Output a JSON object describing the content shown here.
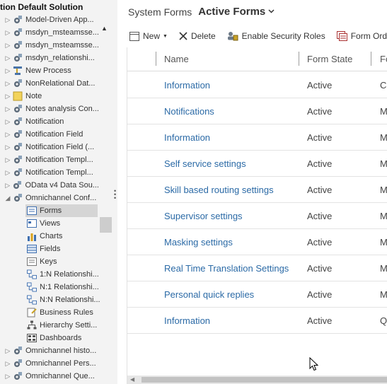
{
  "tree": {
    "title": "tion Default Solution",
    "items": [
      {
        "label": "Model-Driven App...",
        "icon": "gear-icon",
        "expanded": false
      },
      {
        "label": "msdyn_msteamsse...",
        "icon": "gear-icon",
        "expanded": false
      },
      {
        "label": "msdyn_msteamsse...",
        "icon": "gear-icon",
        "expanded": false
      },
      {
        "label": "msdyn_relationshi...",
        "icon": "gear-icon",
        "expanded": false
      },
      {
        "label": "New Process",
        "icon": "process-icon",
        "expanded": false
      },
      {
        "label": "NonRelational Dat...",
        "icon": "gear-icon",
        "expanded": false
      },
      {
        "label": "Note",
        "icon": "note-icon",
        "expanded": false
      },
      {
        "label": "Notes analysis Con...",
        "icon": "gear-icon",
        "expanded": false
      },
      {
        "label": "Notification",
        "icon": "gear-icon",
        "expanded": false
      },
      {
        "label": "Notification Field",
        "icon": "gear-icon",
        "expanded": false
      },
      {
        "label": "Notification Field (...",
        "icon": "gear-icon",
        "expanded": false
      },
      {
        "label": "Notification Templ...",
        "icon": "gear-icon",
        "expanded": false
      },
      {
        "label": "Notification Templ...",
        "icon": "gear-icon",
        "expanded": false
      },
      {
        "label": "OData v4 Data Sou...",
        "icon": "gear-icon",
        "expanded": false
      },
      {
        "label": "Omnichannel Conf...",
        "icon": "gear-icon",
        "expanded": true
      }
    ],
    "children": [
      {
        "label": "Forms",
        "icon": "forms-icon",
        "selected": true
      },
      {
        "label": "Views",
        "icon": "views-icon"
      },
      {
        "label": "Charts",
        "icon": "charts-icon"
      },
      {
        "label": "Fields",
        "icon": "fields-icon"
      },
      {
        "label": "Keys",
        "icon": "keys-icon"
      },
      {
        "label": "1:N Relationshi...",
        "icon": "relationship-icon"
      },
      {
        "label": "N:1 Relationshi...",
        "icon": "relationship-icon"
      },
      {
        "label": "N:N Relationshi...",
        "icon": "relationship-icon"
      },
      {
        "label": "Business Rules",
        "icon": "business-rules-icon"
      },
      {
        "label": "Hierarchy Setti...",
        "icon": "hierarchy-icon"
      },
      {
        "label": "Dashboards",
        "icon": "dashboards-icon"
      }
    ],
    "after": [
      {
        "label": "Omnichannel histo...",
        "icon": "gear-icon"
      },
      {
        "label": "Omnichannel Pers...",
        "icon": "gear-icon"
      },
      {
        "label": "Omnichannel Que...",
        "icon": "gear-icon"
      }
    ]
  },
  "header": {
    "crumb": "System Forms",
    "view": "Active Forms"
  },
  "toolbar": {
    "new_label": "New",
    "delete_label": "Delete",
    "security_label": "Enable Security Roles",
    "form_order_label": "Form Order"
  },
  "grid": {
    "columns": [
      "Name",
      "Form State",
      "Fo"
    ],
    "rows": [
      {
        "name": "Information",
        "state": "Active",
        "extra": "Ca"
      },
      {
        "name": "Notifications",
        "state": "Active",
        "extra": "M"
      },
      {
        "name": "Information",
        "state": "Active",
        "extra": "M"
      },
      {
        "name": "Self service settings",
        "state": "Active",
        "extra": "M"
      },
      {
        "name": "Skill based routing settings",
        "state": "Active",
        "extra": "M"
      },
      {
        "name": "Supervisor settings",
        "state": "Active",
        "extra": "M"
      },
      {
        "name": "Masking settings",
        "state": "Active",
        "extra": "M"
      },
      {
        "name": "Real Time Translation Settings",
        "state": "Active",
        "extra": "M"
      },
      {
        "name": "Personal quick replies",
        "state": "Active",
        "extra": "M"
      },
      {
        "name": "Information",
        "state": "Active",
        "extra": "Q"
      }
    ]
  },
  "colors": {
    "link": "#2b6aa6",
    "tree_bg": "#f3f3f3",
    "selected": "#d5d5d5"
  }
}
